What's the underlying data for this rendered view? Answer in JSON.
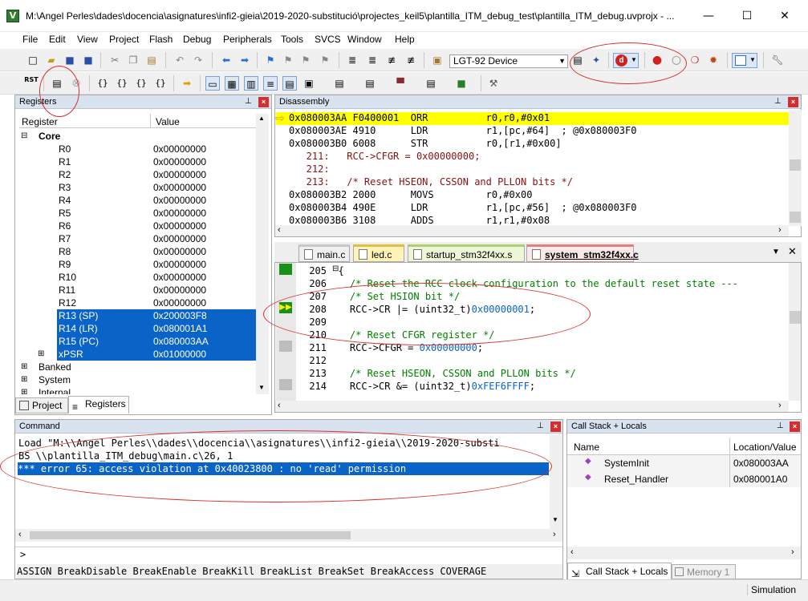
{
  "window": {
    "title": "M:\\Angel Perles\\dades\\docencia\\asignatures\\infi2-gieia\\2019-2020-substitució\\projectes_keil5\\plantilla_ITM_debug_test\\plantilla_ITM_debug.uvprojx - ...",
    "minimize": "—",
    "maximize": "☐",
    "close": "✕"
  },
  "menu": [
    "File",
    "Edit",
    "View",
    "Project",
    "Flash",
    "Debug",
    "Peripherals",
    "Tools",
    "SVCS",
    "Window",
    "Help"
  ],
  "toolbar": {
    "device_label": "LGT-92 Device",
    "debug_icon_label": "d"
  },
  "registers": {
    "title": "Registers",
    "col_register": "Register",
    "col_value": "Value",
    "group_core": "Core",
    "rows": [
      {
        "name": "R0",
        "value": "0x00000000"
      },
      {
        "name": "R1",
        "value": "0x00000000"
      },
      {
        "name": "R2",
        "value": "0x00000000"
      },
      {
        "name": "R3",
        "value": "0x00000000"
      },
      {
        "name": "R4",
        "value": "0x00000000"
      },
      {
        "name": "R5",
        "value": "0x00000000"
      },
      {
        "name": "R6",
        "value": "0x00000000"
      },
      {
        "name": "R7",
        "value": "0x00000000"
      },
      {
        "name": "R8",
        "value": "0x00000000"
      },
      {
        "name": "R9",
        "value": "0x00000000"
      },
      {
        "name": "R10",
        "value": "0x00000000"
      },
      {
        "name": "R11",
        "value": "0x00000000"
      },
      {
        "name": "R12",
        "value": "0x00000000"
      },
      {
        "name": "R13 (SP)",
        "value": "0x200003F8"
      },
      {
        "name": "R14 (LR)",
        "value": "0x080001A1"
      },
      {
        "name": "R15 (PC)",
        "value": "0x080003AA"
      },
      {
        "name": "xPSR",
        "value": "0x01000000"
      }
    ],
    "group_banked": "Banked",
    "group_system": "System",
    "group_internal": "Internal",
    "tab_project": "Project",
    "tab_registers": "Registers"
  },
  "disassembly": {
    "title": "Disassembly",
    "lines": [
      "0x080003AA F0400001  ORR          r0,r0,#0x01",
      "0x080003AE 4910      LDR          r1,[pc,#64]  ; @0x080003F0",
      "0x080003B0 6008      STR          r0,[r1,#0x00]",
      "   211:   RCC->CFGR = 0x00000000;",
      "   212: ",
      "   213:   /* Reset HSEON, CSSON and PLLON bits */",
      "0x080003B2 2000      MOVS         r0,#0x00",
      "0x080003B4 490E      LDR          r1,[pc,#56]  ; @0x080003F0",
      "0x080003B6 3108      ADDS         r1,r1,#0x08"
    ]
  },
  "editor": {
    "tabs": [
      "main.c",
      "led.c",
      "startup_stm32f4xx.s",
      "system_stm32f4xx.c"
    ],
    "lines": [
      {
        "n": "205",
        "code": "{",
        "comment": "",
        "hex": ""
      },
      {
        "n": "206",
        "code": "  ",
        "comment": "/* Reset the RCC clock configuration to the default reset state ---",
        "hex": ""
      },
      {
        "n": "207",
        "code": "  ",
        "comment": "/* Set HSION bit */",
        "hex": ""
      },
      {
        "n": "208",
        "code": "  RCC->CR |= (uint32_t)",
        "comment": "",
        "hex": "0x00000001",
        ";": ";"
      },
      {
        "n": "209",
        "code": "",
        "comment": "",
        "hex": ""
      },
      {
        "n": "210",
        "code": "  ",
        "comment": "/* Reset CFGR register */",
        "hex": ""
      },
      {
        "n": "211",
        "code": "  RCC->CFGR = ",
        "comment": "",
        "hex": "0x00000000"
      },
      {
        "n": "212",
        "code": "",
        "comment": "",
        "hex": ""
      },
      {
        "n": "213",
        "code": "  ",
        "comment": "/* Reset HSEON, CSSON and PLLON bits */",
        "hex": ""
      },
      {
        "n": "214",
        "code": "  RCC->CR &= (uint32_t)",
        "comment": "",
        "hex": "0xFEF6FFFF"
      }
    ],
    "suffix_208": ";",
    "suffix_211": ";",
    "suffix_214": ";"
  },
  "command": {
    "title": "Command",
    "lines": [
      "Load \"M:\\\\Angel Perles\\\\dades\\\\docencia\\\\asignatures\\\\infi2-gieia\\\\2019-2020-substi",
      "BS \\\\plantilla_ITM_debug\\main.c\\26, 1",
      "*** error 65: access violation at 0x40023800 : no 'read' permission"
    ],
    "prompt": ">",
    "keywords": "ASSIGN BreakDisable BreakEnable BreakKill BreakList BreakSet BreakAccess COVERAGE"
  },
  "callstack": {
    "title": "Call Stack + Locals",
    "col_name": "Name",
    "col_location": "Location/Value",
    "rows": [
      {
        "name": "SystemInit",
        "value": "0x080003AA"
      },
      {
        "name": "Reset_Handler",
        "value": "0x080001A0"
      }
    ],
    "tab_callstack": "Call Stack + Locals",
    "tab_memory": "Memory 1"
  },
  "status": {
    "mode": "Simulation"
  },
  "colors": {
    "selection": "#0a64c8",
    "current_line": "#ffff00",
    "annotation": "#d9302c"
  }
}
